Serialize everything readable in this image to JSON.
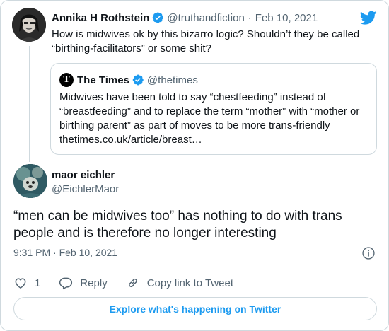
{
  "original_tweet": {
    "author_name": "Annika H Rothstein",
    "handle": "@truthandfiction",
    "separator": "·",
    "date": "Feb 10, 2021",
    "text": "How is midwives ok by this bizarro logic? Shouldn’t they be called “birthing-facilitators” or some shit?"
  },
  "quoted_tweet": {
    "logo_letter": "T",
    "author_name": "The Times",
    "handle": "@thetimes",
    "text": "Midwives have been told to say “chestfeeding” instead of “breastfeeding” and to replace the term “mother” with “mother or birthing parent” as part of moves to be more trans-friendly",
    "link": "thetimes.co.uk/article/breast…"
  },
  "main_tweet": {
    "author_name": "maor eichler",
    "handle": "@EichlerMaor",
    "text": "“men can be midwives too” has nothing to do with trans people and is therefore no longer interesting",
    "time": "9:31 PM · Feb 10, 2021"
  },
  "actions": {
    "like_count": "1",
    "reply_label": "Reply",
    "copy_link_label": "Copy link to Tweet"
  },
  "explore_label": "Explore what's happening on Twitter",
  "icons": {
    "brand": "twitter-bird-icon",
    "verified": "verified-badge-icon",
    "info": "info-icon",
    "like": "heart-icon",
    "reply": "reply-bubble-icon",
    "link": "link-icon"
  },
  "colors": {
    "accent": "#1d9bf0",
    "text": "#0f1419",
    "muted": "#536471",
    "border": "#cfd9de"
  }
}
